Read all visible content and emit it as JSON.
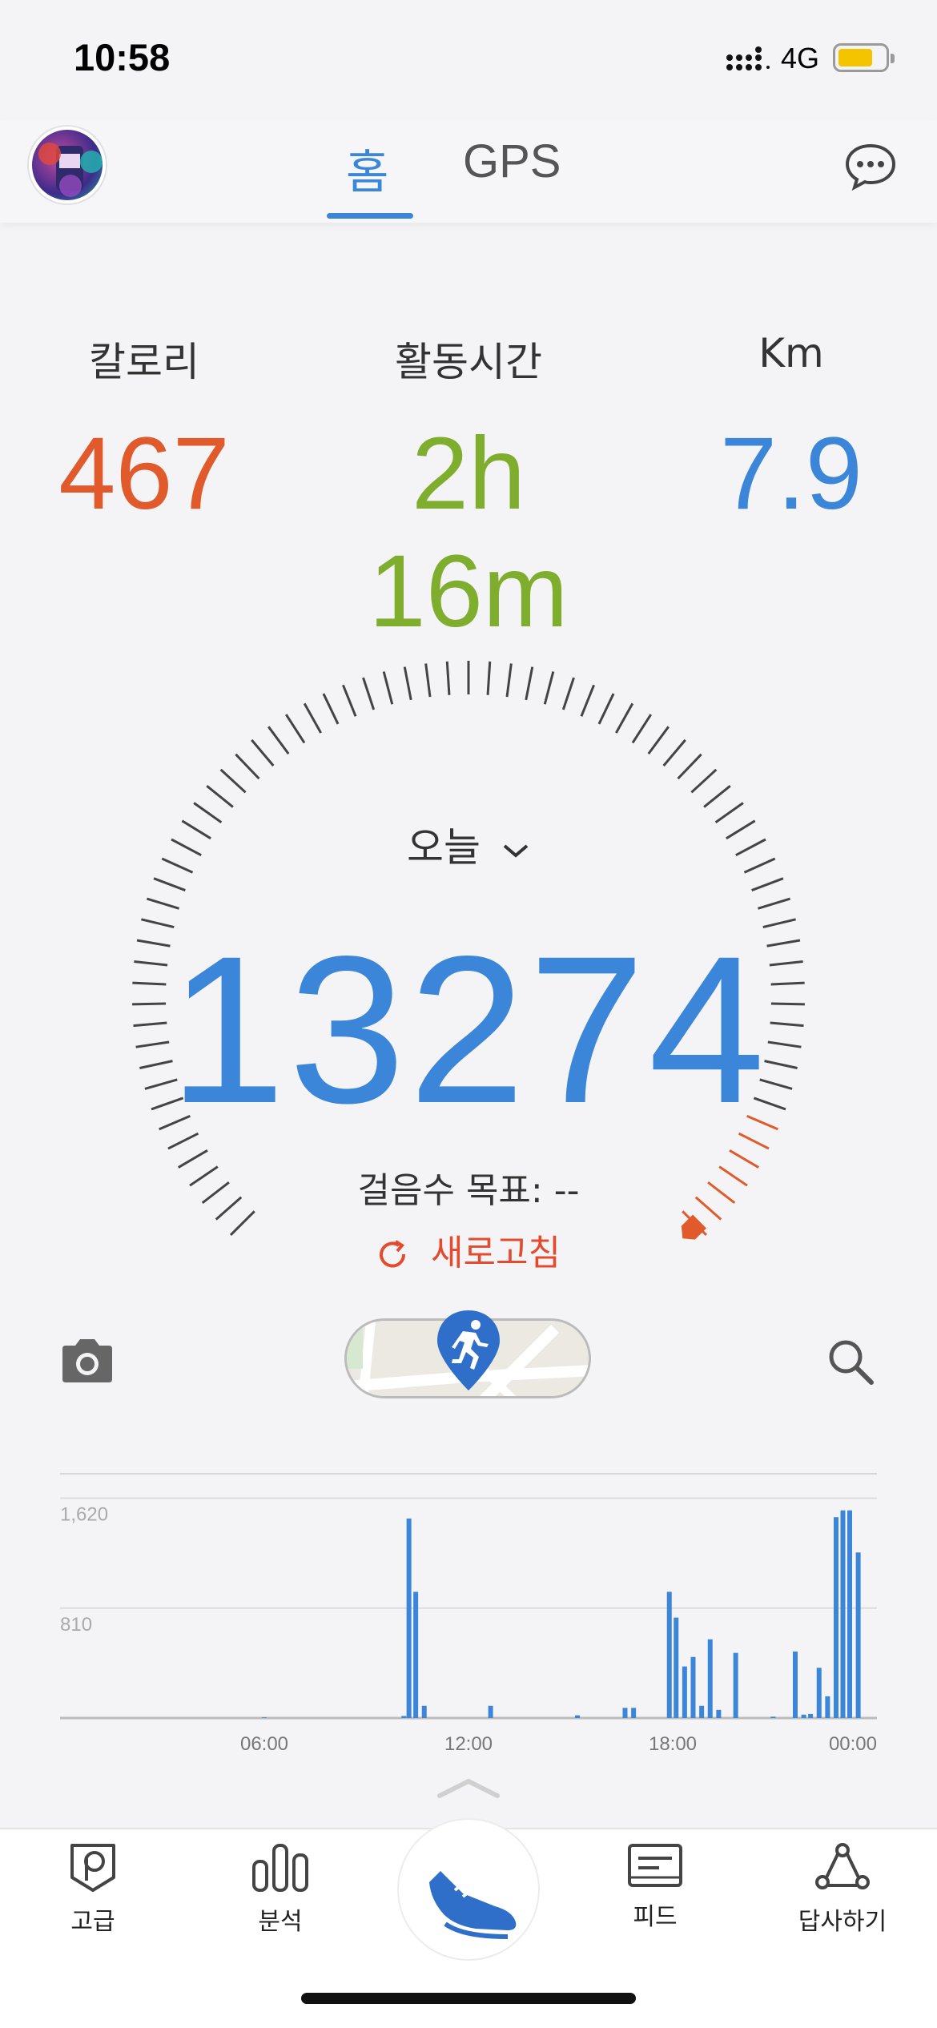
{
  "status_bar": {
    "time": "10:58",
    "network": "4G"
  },
  "header": {
    "tabs": [
      {
        "label": "홈",
        "active": true
      },
      {
        "label": "GPS",
        "active": false
      }
    ]
  },
  "stats": [
    {
      "label": "칼로리",
      "value": "467",
      "color": "#e05a2b"
    },
    {
      "label": "활동시간",
      "value": "2h 16m",
      "color": "#7fae2e"
    },
    {
      "label": "Km",
      "value": "7.9",
      "color": "#3b86d9"
    }
  ],
  "gauge": {
    "period": "오늘",
    "steps": "13274",
    "goal_text": "걸음수 목표: --",
    "refresh_label": "새로고침",
    "accent": "#e05a2b"
  },
  "chart_data": {
    "type": "bar",
    "yticks": [
      "1,620",
      "810"
    ],
    "ylim": [
      0,
      1800
    ],
    "xticks": [
      "06:00",
      "12:00",
      "18:00",
      "00:00"
    ],
    "color": "#3b86d9",
    "bars": [
      {
        "x": 6.0,
        "value": 5
      },
      {
        "x": 10.1,
        "value": 15
      },
      {
        "x": 10.25,
        "value": 1470
      },
      {
        "x": 10.45,
        "value": 930
      },
      {
        "x": 10.7,
        "value": 90
      },
      {
        "x": 12.65,
        "value": 90
      },
      {
        "x": 15.2,
        "value": 20
      },
      {
        "x": 16.6,
        "value": 75
      },
      {
        "x": 16.85,
        "value": 75
      },
      {
        "x": 17.9,
        "value": 930
      },
      {
        "x": 18.1,
        "value": 740
      },
      {
        "x": 18.35,
        "value": 380
      },
      {
        "x": 18.6,
        "value": 450
      },
      {
        "x": 18.85,
        "value": 90
      },
      {
        "x": 19.1,
        "value": 580
      },
      {
        "x": 19.35,
        "value": 60
      },
      {
        "x": 19.85,
        "value": 480
      },
      {
        "x": 20.95,
        "value": 10
      },
      {
        "x": 21.6,
        "value": 490
      },
      {
        "x": 21.85,
        "value": 25
      },
      {
        "x": 22.05,
        "value": 30
      },
      {
        "x": 22.3,
        "value": 370
      },
      {
        "x": 22.55,
        "value": 160
      },
      {
        "x": 22.8,
        "value": 1480
      },
      {
        "x": 23.0,
        "value": 1530
      },
      {
        "x": 23.2,
        "value": 1530
      },
      {
        "x": 23.45,
        "value": 1220
      }
    ]
  },
  "nav": [
    {
      "label": "고급",
      "icon": "premium-icon"
    },
    {
      "label": "분석",
      "icon": "bar-chart-icon"
    },
    {
      "label": "",
      "icon": "shoe-icon"
    },
    {
      "label": "피드",
      "icon": "feed-icon"
    },
    {
      "label": "답사하기",
      "icon": "explore-icon"
    }
  ]
}
